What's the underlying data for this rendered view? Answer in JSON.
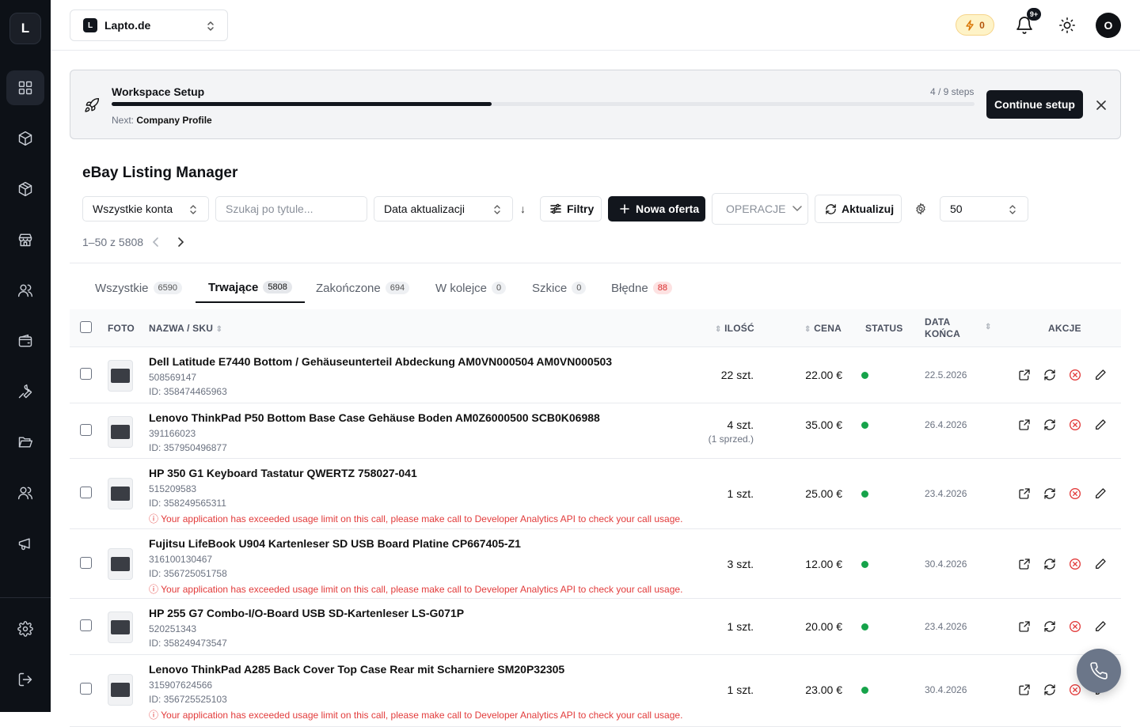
{
  "sidebar": {
    "logo_letter": "L"
  },
  "topbar": {
    "store": {
      "badge": "L",
      "name": "Lapto.de"
    },
    "credits": "0",
    "notifications_badge": "9+",
    "avatar_letter": "O"
  },
  "setup": {
    "title": "Workspace Setup",
    "steps": "4 / 9 steps",
    "progress_fraction": 0.44,
    "next_label": "Next:",
    "next_value": "Company Profile",
    "continue_label": "Continue setup"
  },
  "page": {
    "title": "eBay Listing Manager",
    "account_filter": "Wszystkie konta",
    "search_placeholder": "Szukaj po tytule...",
    "sort_field": "Data aktualizacji",
    "sort_dir": "↓",
    "filters_label": "Filtry",
    "new_offer_label": "Nowa oferta",
    "operations_label": "OPERACJE",
    "update_label": "Aktualizuj",
    "page_size": "50",
    "pager_text": "1–50 z 5808"
  },
  "tabs": [
    {
      "label": "Wszystkie",
      "count": "6590"
    },
    {
      "label": "Trwające",
      "count": "5808"
    },
    {
      "label": "Zakończone",
      "count": "694"
    },
    {
      "label": "W kolejce",
      "count": "0"
    },
    {
      "label": "Szkice",
      "count": "0"
    },
    {
      "label": "Błędne",
      "count": "88"
    }
  ],
  "table": {
    "headers": {
      "foto": "FOTO",
      "name": "NAZWA / SKU",
      "qty": "ILOŚĆ",
      "price": "CENA",
      "status": "STATUS",
      "end1": "DATA",
      "end2": "KOŃCA",
      "actions": "AKCJE"
    },
    "rows": [
      {
        "title": "Dell Latitude E7440 Bottom / Gehäuseunterteil Abdeckung AM0VN000504 AM0VN000503",
        "sku": "508569147",
        "id": "ID: 358474465963",
        "qty": "22 szt.",
        "sold": "",
        "price": "22.00 €",
        "status": "active",
        "end_date": "22.5.2026",
        "error": ""
      },
      {
        "title": "Lenovo ThinkPad P50 Bottom Base Case Gehäuse Boden AM0Z6000500 SCB0K06988",
        "sku": "391166023",
        "id": "ID: 357950496877",
        "qty": "4 szt.",
        "sold": "(1 sprzed.)",
        "price": "35.00 €",
        "status": "active",
        "end_date": "26.4.2026",
        "error": ""
      },
      {
        "title": "HP 350 G1 Keyboard Tastatur QWERTZ 758027-041",
        "sku": "515209583",
        "id": "ID: 358249565311",
        "qty": "1 szt.",
        "sold": "",
        "price": "25.00 €",
        "status": "active",
        "end_date": "23.4.2026",
        "error": "Your application has exceeded usage limit on this call, please make call to Developer Analytics API to check your call usage."
      },
      {
        "title": "Fujitsu LifeBook U904 Kartenleser SD USB Board Platine CP667405-Z1",
        "sku": "316100130467",
        "id": "ID: 356725051758",
        "qty": "3 szt.",
        "sold": "",
        "price": "12.00 €",
        "status": "active",
        "end_date": "30.4.2026",
        "error": "Your application has exceeded usage limit on this call, please make call to Developer Analytics API to check your call usage."
      },
      {
        "title": "HP 255 G7 Combo-I/O-Board USB SD-Kartenleser LS-G071P",
        "sku": "520251343",
        "id": "ID: 358249473547",
        "qty": "1 szt.",
        "sold": "",
        "price": "20.00 €",
        "status": "active",
        "end_date": "23.4.2026",
        "error": ""
      },
      {
        "title": "Lenovo ThinkPad A285 Back Cover Top Case Rear mit Scharniere SM20P32305",
        "sku": "315907624566",
        "id": "ID: 356725525103",
        "qty": "1 szt.",
        "sold": "",
        "price": "23.00 €",
        "status": "active",
        "end_date": "30.4.2026",
        "error": "Your application has exceeded usage limit on this call, please make call to Developer Analytics API to check your call usage."
      }
    ]
  },
  "colors": {
    "accent": "#12161d",
    "status_active": "#16a34a",
    "error": "#e23b3b",
    "credits_bg": "#fef3c7"
  }
}
